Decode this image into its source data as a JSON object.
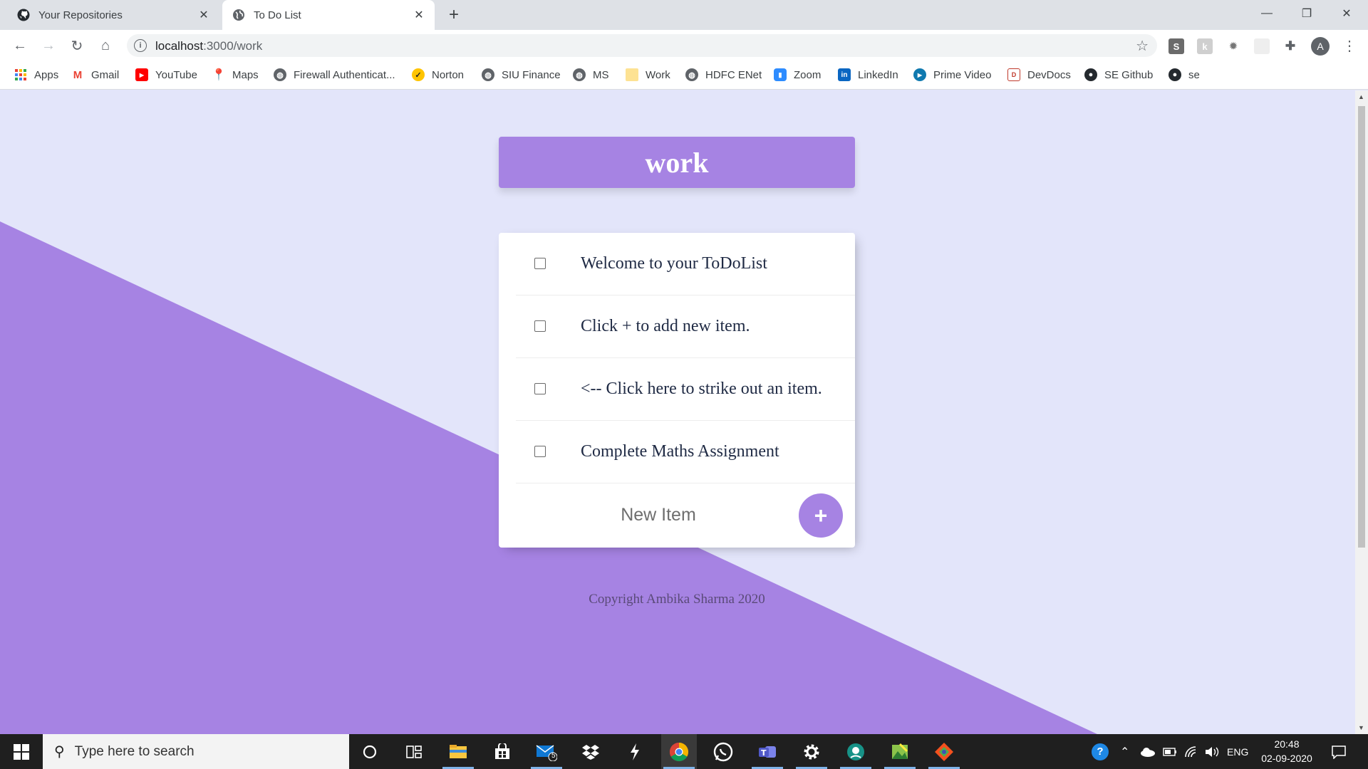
{
  "browser": {
    "tabs": [
      {
        "title": "Your Repositories",
        "icon": "github-icon",
        "active": false
      },
      {
        "title": "To Do List",
        "icon": "globe-icon",
        "active": true
      }
    ],
    "url_host": "localhost",
    "url_path": ":3000/work",
    "bookmarks": [
      {
        "label": "Apps",
        "icon": "apps-grid-icon"
      },
      {
        "label": "Gmail",
        "icon": "gmail-icon"
      },
      {
        "label": "YouTube",
        "icon": "youtube-icon"
      },
      {
        "label": "Maps",
        "icon": "maps-pin-icon"
      },
      {
        "label": "Firewall Authenticat...",
        "icon": "globe-icon"
      },
      {
        "label": "Norton",
        "icon": "norton-check-icon"
      },
      {
        "label": "SIU Finance",
        "icon": "globe-icon"
      },
      {
        "label": "MS",
        "icon": "globe-icon"
      },
      {
        "label": "Work",
        "icon": "folder-icon"
      },
      {
        "label": "HDFC ENet",
        "icon": "globe-icon"
      },
      {
        "label": "Zoom",
        "icon": "zoom-icon"
      },
      {
        "label": "LinkedIn",
        "icon": "linkedin-icon"
      },
      {
        "label": "Prime Video",
        "icon": "prime-video-icon"
      },
      {
        "label": "DevDocs",
        "icon": "devdocs-icon"
      },
      {
        "label": "SE Github",
        "icon": "github-icon"
      },
      {
        "label": "se",
        "icon": "github-icon"
      }
    ],
    "profile_initial": "A"
  },
  "page": {
    "list_title": "work",
    "items": [
      {
        "text": "Welcome to your ToDoList",
        "checked": false
      },
      {
        "text": "Click + to add new item.",
        "checked": false
      },
      {
        "text": "<-- Click here to strike out an item.",
        "checked": false
      },
      {
        "text": "Complete Maths Assignment",
        "checked": false
      }
    ],
    "new_item_placeholder": "New Item",
    "add_button_label": "+",
    "footer": "Copyright Ambika Sharma 2020",
    "colors": {
      "accent": "#A683E3",
      "background": "#E3E5FA"
    }
  },
  "taskbar": {
    "search_placeholder": "Type here to search",
    "mail_badge": "5",
    "language": "ENG",
    "time": "20:48",
    "date": "02-09-2020"
  }
}
